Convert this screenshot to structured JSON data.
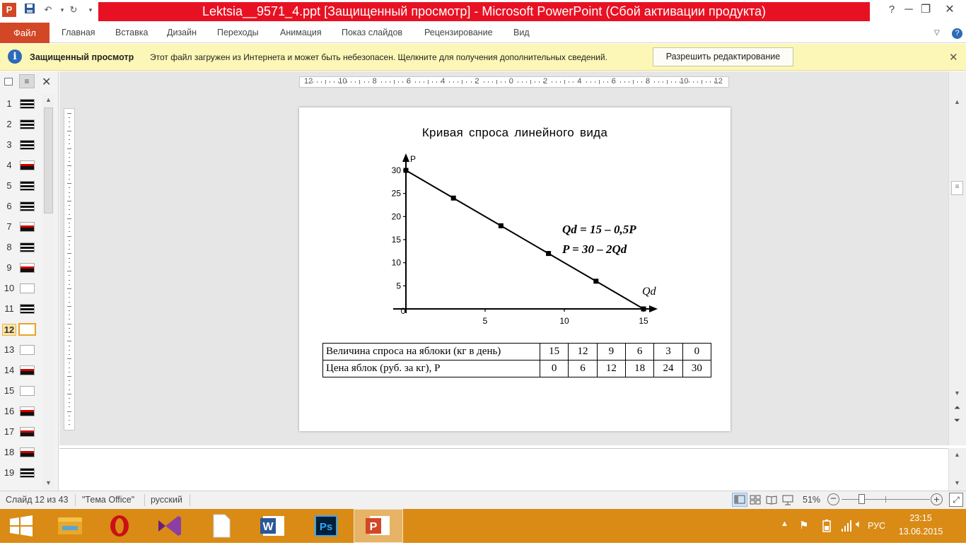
{
  "window": {
    "title": "Lektsia__9571_4.ppt [Защищенный просмотр] - Microsoft PowerPoint (Сбой активации продукта)",
    "help": "?",
    "minimize": "─",
    "restore": "❐",
    "close": "✕"
  },
  "ribbon": {
    "file_tab": "Файл",
    "tabs": [
      "Главная",
      "Вставка",
      "Дизайн",
      "Переходы",
      "Анимация",
      "Показ слайдов",
      "Рецензирование",
      "Вид"
    ]
  },
  "protected_view": {
    "title": "Защищенный просмотр",
    "message": "Этот файл загружен из Интернета и может быть небезопасен. Щелкните для получения дополнительных сведений.",
    "enable_button": "Разрешить редактирование"
  },
  "slides_panel": {
    "numbers": [
      "1",
      "2",
      "3",
      "4",
      "5",
      "6",
      "7",
      "8",
      "9",
      "10",
      "11",
      "12",
      "13",
      "14",
      "15",
      "16",
      "17",
      "18",
      "19"
    ],
    "selected": "12"
  },
  "ruler": {
    "labels": [
      "12",
      "10",
      "8",
      "6",
      "4",
      "2",
      "0",
      "2",
      "4",
      "6",
      "8",
      "10",
      "12"
    ]
  },
  "slide": {
    "title": "Кривая спроса линейного вида",
    "y_label": "P",
    "x_label": "Qd",
    "formula1": "Qd = 15 – 0,5P",
    "formula2": "P = 30 – 2Qd",
    "table": {
      "row1_label": "Величина спроса на яблоки (кг в день)",
      "row1_values": [
        "15",
        "12",
        "9",
        "6",
        "3",
        "0"
      ],
      "row2_label": "Цена яблок (руб. за кг), P",
      "row2_values": [
        "0",
        "6",
        "12",
        "18",
        "24",
        "30"
      ]
    }
  },
  "chart_data": {
    "type": "line",
    "x": [
      0,
      3,
      6,
      9,
      12,
      15
    ],
    "y": [
      30,
      24,
      18,
      12,
      6,
      0
    ],
    "xlim": [
      0,
      15
    ],
    "ylim": [
      0,
      30
    ],
    "x_ticks": [
      "0",
      "5",
      "10",
      "15"
    ],
    "y_ticks": [
      "30",
      "25",
      "20",
      "15",
      "10",
      "5"
    ],
    "xlabel": "Qd",
    "ylabel": "P"
  },
  "statusbar": {
    "slide_info": "Слайд 12 из 43",
    "theme": "\"Тема Office\"",
    "language": "русский",
    "zoom": "51%"
  },
  "taskbar": {
    "language": "РУС",
    "time": "23:15",
    "date": "13.06.2015"
  }
}
